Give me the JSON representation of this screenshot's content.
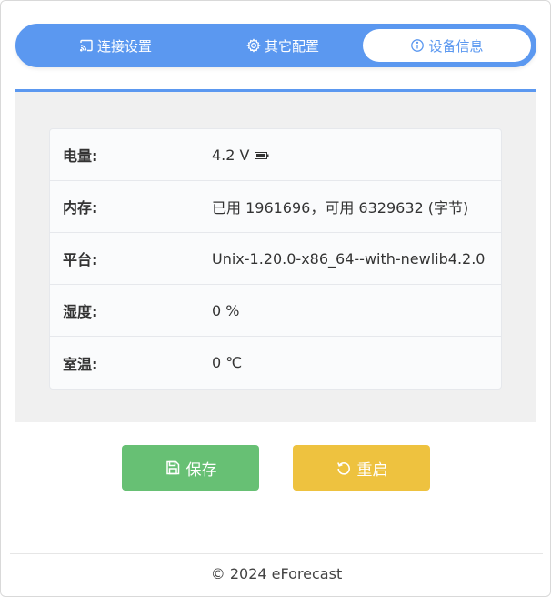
{
  "tabs": [
    {
      "label": "连接设置",
      "icon": "cast-icon",
      "active": false
    },
    {
      "label": "其它配置",
      "icon": "gear-icon",
      "active": false
    },
    {
      "label": "设备信息",
      "icon": "info-icon",
      "active": true
    }
  ],
  "info": {
    "rows": [
      {
        "key": "电量:",
        "value": "4.2 V",
        "icon": "battery-icon"
      },
      {
        "key": "内存:",
        "value": "已用 1961696，可用 6329632 (字节)"
      },
      {
        "key": "平台:",
        "value": "Unix-1.20.0-x86_64--with-newlib4.2.0"
      },
      {
        "key": "湿度:",
        "value": "0 %"
      },
      {
        "key": "室温:",
        "value": "0 ℃"
      }
    ]
  },
  "actions": {
    "save_label": "保存",
    "restart_label": "重启"
  },
  "footer": {
    "text": "© 2024 eForecast"
  },
  "colors": {
    "accent": "#5b98f0",
    "save": "#67c074",
    "restart": "#eec23f"
  }
}
